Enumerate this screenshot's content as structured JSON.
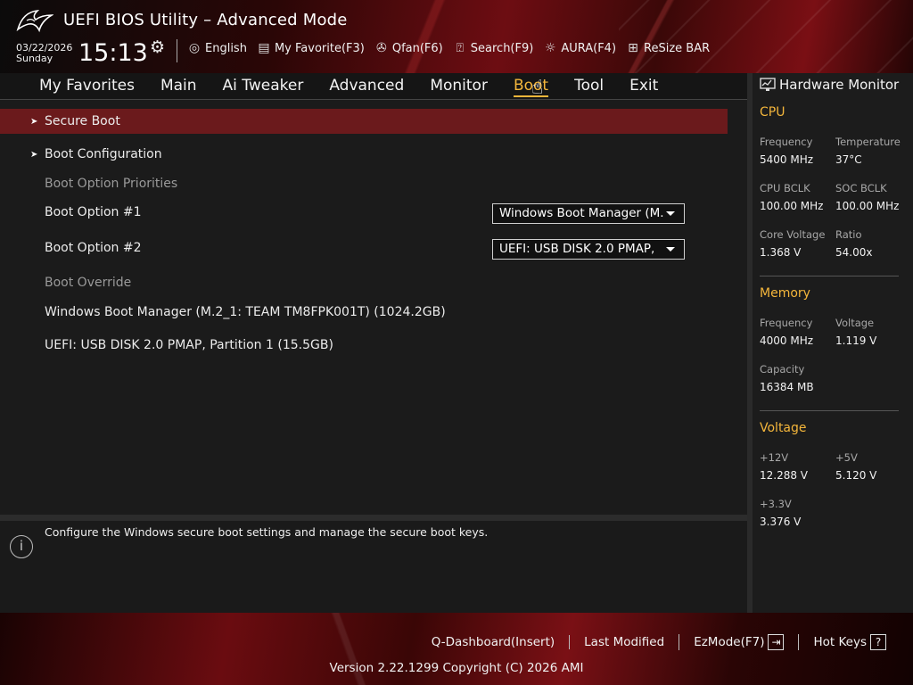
{
  "header": {
    "title": "UEFI BIOS Utility – Advanced Mode",
    "date": "03/22/2026",
    "day": "Sunday",
    "time": "15:13",
    "toolbar": [
      {
        "label": "English",
        "icon": "globe-icon"
      },
      {
        "label": "My Favorite(F3)",
        "icon": "favorite-icon"
      },
      {
        "label": "Qfan(F6)",
        "icon": "fan-icon"
      },
      {
        "label": "Search(F9)",
        "icon": "search-icon"
      },
      {
        "label": "AURA(F4)",
        "icon": "aura-icon"
      },
      {
        "label": "ReSize BAR",
        "icon": "resize-bar-icon"
      }
    ]
  },
  "nav": {
    "tabs": [
      "My Favorites",
      "Main",
      "Ai Tweaker",
      "Advanced",
      "Monitor",
      "Boot",
      "Tool",
      "Exit"
    ],
    "active": "Boot"
  },
  "main": {
    "secure_boot": "Secure Boot",
    "boot_configuration": "Boot Configuration",
    "boot_option_priorities": "Boot Option Priorities",
    "boot_option_1": {
      "label": "Boot Option #1",
      "value": "Windows Boot Manager (M."
    },
    "boot_option_2": {
      "label": "Boot Option #2",
      "value": "UEFI:  USB DISK 2.0 PMAP,"
    },
    "boot_override": "Boot Override",
    "override_1": "Windows Boot Manager (M.2_1: TEAM TM8FPK001T) (1024.2GB)",
    "override_2": "UEFI:  USB DISK 2.0 PMAP, Partition 1 (15.5GB)"
  },
  "help": {
    "text": "Configure the Windows secure boot settings and manage the secure boot keys."
  },
  "hardware_monitor": {
    "title": "Hardware Monitor",
    "cpu": {
      "heading": "CPU",
      "frequency_label": "Frequency",
      "frequency": "5400 MHz",
      "temperature_label": "Temperature",
      "temperature": "37°C",
      "bclk_label": "CPU BCLK",
      "bclk": "100.00 MHz",
      "soc_bclk_label": "SOC BCLK",
      "soc_bclk": "100.00 MHz",
      "core_voltage_label": "Core Voltage",
      "core_voltage": "1.368 V",
      "ratio_label": "Ratio",
      "ratio": "54.00x"
    },
    "memory": {
      "heading": "Memory",
      "frequency_label": "Frequency",
      "frequency": "4000 MHz",
      "voltage_label": "Voltage",
      "voltage": "1.119 V",
      "capacity_label": "Capacity",
      "capacity": "16384 MB"
    },
    "voltage": {
      "heading": "Voltage",
      "v12_label": "+12V",
      "v12": "12.288 V",
      "v5_label": "+5V",
      "v5": "5.120 V",
      "v33_label": "+3.3V",
      "v33": "3.376 V"
    }
  },
  "footer": {
    "q_dashboard": "Q-Dashboard(Insert)",
    "last_modified": "Last Modified",
    "ezmode": "EzMode(F7)",
    "hot_keys": "Hot Keys",
    "version": "Version 2.22.1299 Copyright (C) 2026 AMI"
  },
  "colors": {
    "accent": "#f4b63b",
    "selected_row": "#6b1a1c",
    "brand_red": "#7a0f14"
  }
}
